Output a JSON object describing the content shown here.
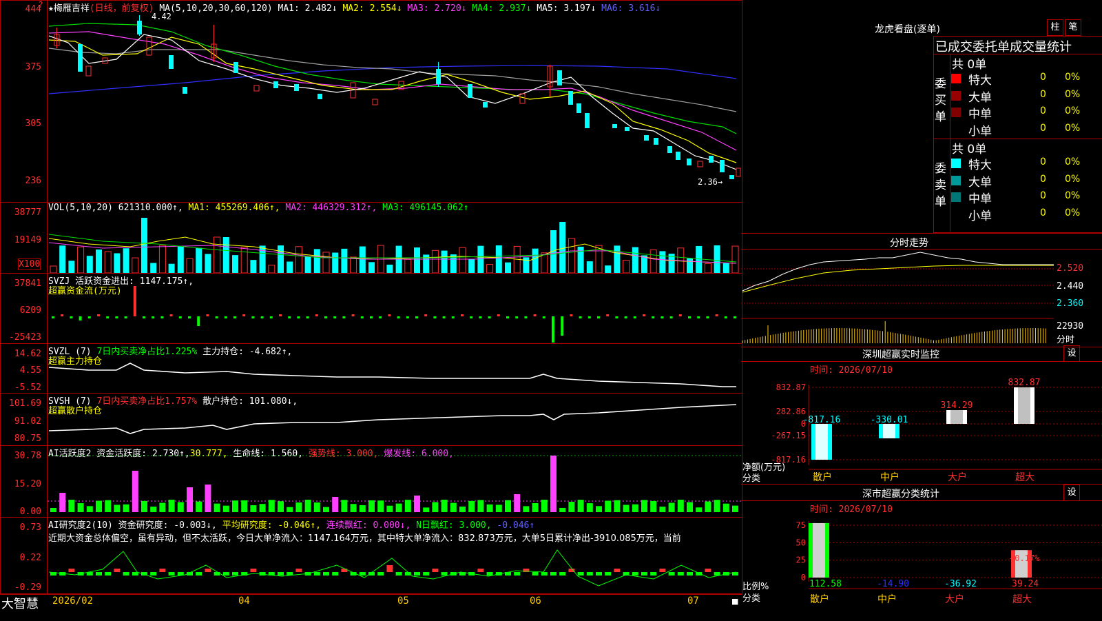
{
  "main_header": {
    "star": "★",
    "name": "梅雁吉祥",
    "period": "(日线，前复权)",
    "ma_label": "MA(5,10,20,30,60,120)",
    "ma1": "MA1: 2.482↓",
    "ma2": "MA2: 2.554↓",
    "ma3": "MA3: 2.720↓",
    "ma4": "MA4: 2.937↓",
    "ma5": "MA5: 3.197↓",
    "ma6": "MA6: 3.616↓",
    "high_mark": "4.42",
    "low_mark": "2.36→"
  },
  "price_axis": [
    "444",
    "375",
    "305",
    "236"
  ],
  "vol_header": {
    "label": "VOL(5,10,20)",
    "value": "621310.000↑,",
    "ma1": "MA1: 455269.406↑,",
    "ma2": "MA2: 446329.312↑,",
    "ma3": "MA3: 496145.062↑"
  },
  "vol_axis": [
    "38777",
    "19149",
    "X100"
  ],
  "svzj_header": {
    "label": "SVZJ  活跃资金进出: 1147.175↑,",
    "sub": "超赢资金流(万元)"
  },
  "svzj_axis": [
    "37841",
    "6209",
    "-25423"
  ],
  "svzl_header": {
    "label": "SVZL (7)",
    "pct": "7日内买卖净占比1.225%",
    "hold": "主力持仓: -4.682↑,",
    "sub": "超赢主力持仓"
  },
  "svzl_axis": [
    "14.62",
    "4.55",
    "-5.52"
  ],
  "svsh_header": {
    "label": "SVSH (7)",
    "pct": "7日内买卖净占比1.757%",
    "hold": "散户持仓: 101.080↓,",
    "sub": "超赢散户持仓"
  },
  "svsh_axis": [
    "101.69",
    "91.02",
    "80.75"
  ],
  "ai1_header": {
    "label": "AI活跃度2 资金活跃度: 2.730↑,",
    "v2": "30.777,",
    "life": "生命线: 1.560,",
    "strong": "强势线: 3.000,",
    "burst": "爆发线: 6.000,"
  },
  "ai1_axis": [
    "30.78",
    "15.20",
    "0.00"
  ],
  "ai2_header": {
    "label": "AI研究度2(10) 资金研究度: -0.003↓,",
    "avg": "平均研究度: -0.046↑,",
    "cont": "连续飘红: 0.000↓,",
    "nday": "N日飘红: 3.000,",
    "last": "-0.046↑"
  },
  "ai2_axis": [
    "0.73",
    "0.22",
    "-0.29"
  ],
  "ai2_text": "近期大资金总体偏空，虽有异动，但不太活跃，今日大单净流入：1147.164万元，其中特大单净流入：832.873万元，大单5日累计净出-3910.085万元，当前",
  "x_axis": {
    "brand": "大智慧",
    "labels": [
      "2026/02",
      "04",
      "05",
      "06",
      "07"
    ]
  },
  "right_panel": {
    "title": "龙虎看盘(逐单)",
    "btn_bar": "柱",
    "btn_pen": "笔",
    "stats_title": "已成交委托单成交量统计",
    "buy_side": "委买单",
    "sell_side": "委卖单",
    "buy_total": "共 0单",
    "sell_total": "共 0单",
    "rows": [
      {
        "label": "特大",
        "count": "0",
        "pct": "0%"
      },
      {
        "label": "大单",
        "count": "0",
        "pct": "0%"
      },
      {
        "label": "中单",
        "count": "0",
        "pct": "0%"
      },
      {
        "label": "小单",
        "count": "0",
        "pct": "0%"
      }
    ],
    "buy_colors": [
      "#ff0000",
      "#990000",
      "#800000",
      "#000000"
    ],
    "sell_colors": [
      "#00ffff",
      "#009999",
      "#007777",
      "#000000"
    ],
    "intraday_title": "分时走势",
    "intraday_axis": [
      "2.520",
      "2.440",
      "2.360",
      "22930"
    ],
    "intraday_footer": "分时",
    "monitor_title": "深圳超赢实时监控",
    "monitor_set": "设",
    "monitor_time": "时间: 2026/07/10",
    "monitor_axis": [
      "832.87",
      "282.86",
      "0",
      "-267.15",
      "-817.16"
    ],
    "monitor_ylabel": "净额(万元)",
    "monitor_xlabel": "分类",
    "class_title": "深市超赢分类统计",
    "class_set": "设",
    "class_time": "时间: 2026/07/10",
    "class_axis": [
      "75",
      "50",
      "25",
      "0"
    ],
    "class_pct": "+0.17%",
    "class_ylabel": "比例%",
    "class_xlabel": "分类"
  },
  "chart_data": [
    {
      "type": "bar",
      "title": "深圳超赢实时监控",
      "categories": [
        "散户",
        "中户",
        "大户",
        "超大"
      ],
      "values": [
        -817.16,
        -330.01,
        314.29,
        832.87
      ],
      "ylabel": "净额(万元)",
      "ylim": [
        -817.16,
        832.87
      ]
    },
    {
      "type": "bar",
      "title": "深市超赢分类统计",
      "categories": [
        "散户",
        "中户",
        "大户",
        "超大"
      ],
      "values": [
        112.58,
        -14.9,
        -36.92,
        39.24
      ],
      "ylabel": "比例%",
      "ylim": [
        0,
        75
      ]
    }
  ]
}
